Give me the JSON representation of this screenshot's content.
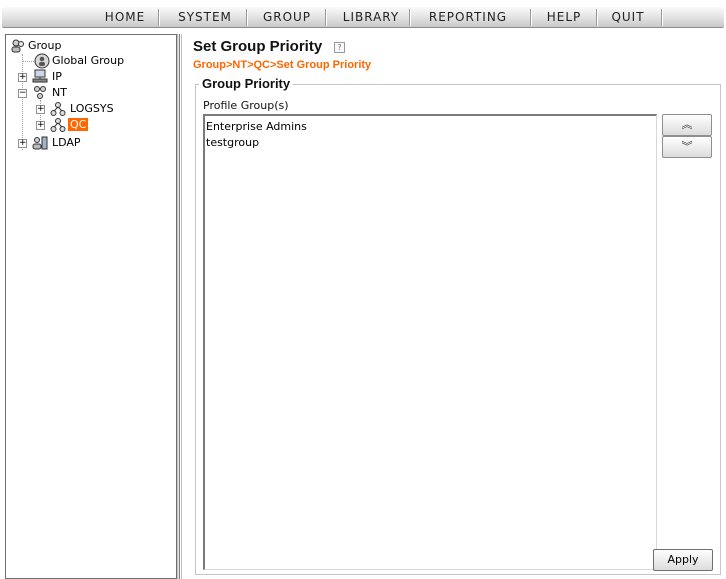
{
  "menu": {
    "items": [
      {
        "label": "HOME"
      },
      {
        "label": "SYSTEM"
      },
      {
        "label": "GROUP"
      },
      {
        "label": "LIBRARY"
      },
      {
        "label": "REPORTING"
      },
      {
        "label": "HELP"
      },
      {
        "label": "QUIT"
      }
    ]
  },
  "tree": {
    "root": "Group",
    "global_group": "Global Group",
    "ip": "IP",
    "nt": "NT",
    "logsys": "LOGSYS",
    "qc": "QC",
    "ldap": "LDAP",
    "expand_glyph": "+",
    "collapse_glyph": "−"
  },
  "page": {
    "title": "Set Group Priority",
    "help_glyph": "?",
    "breadcrumb": "Group>NT>QC>Set Group Priority",
    "section_title": "Group Priority",
    "list_label": "Profile Group(s)",
    "profile_groups": [
      "Enterprise Admins",
      "testgroup"
    ],
    "move_up_glyph": "︽",
    "move_down_glyph": "︾",
    "apply_label": "Apply"
  },
  "colors": {
    "accent": "#ff6600",
    "selected_bg": "#ff6600"
  }
}
